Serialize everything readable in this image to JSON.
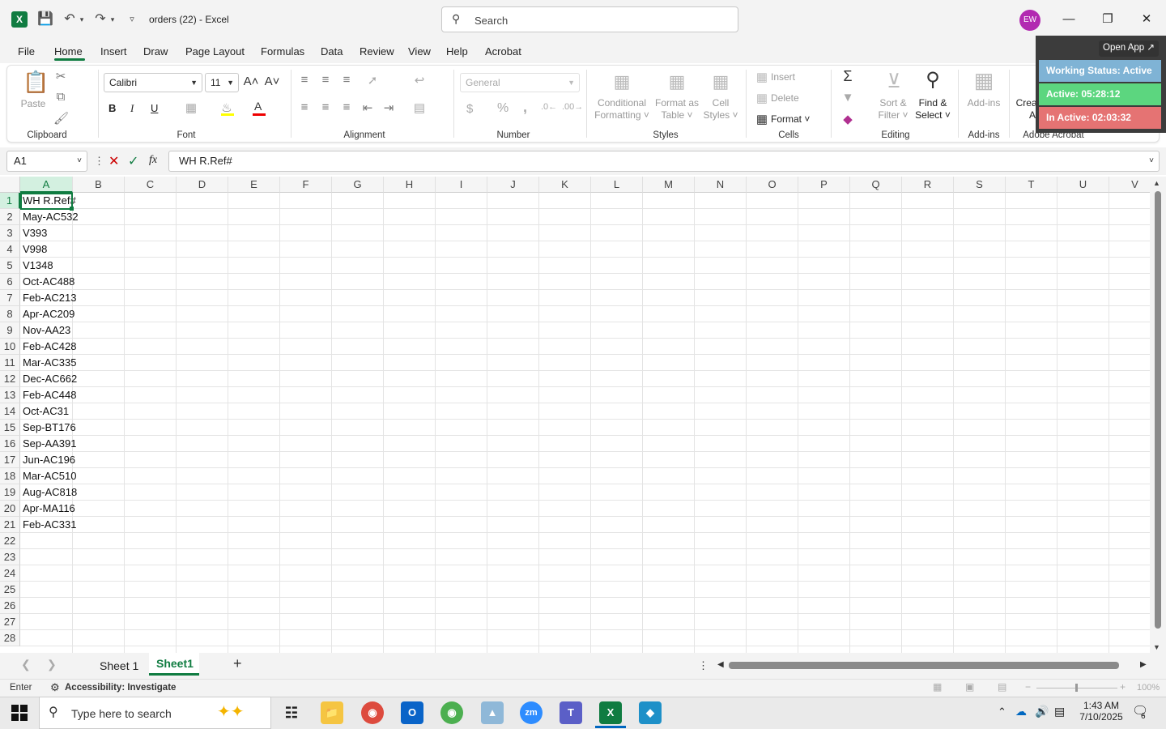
{
  "app": {
    "title": "orders (22)  -  Excel",
    "logo": "X",
    "search_placeholder": "Search",
    "avatar": "EW"
  },
  "menu": [
    "File",
    "Home",
    "Insert",
    "Draw",
    "Page Layout",
    "Formulas",
    "Data",
    "Review",
    "View",
    "Help",
    "Acrobat"
  ],
  "ribbon": {
    "clipboard": {
      "paste": "Paste",
      "label": "Clipboard"
    },
    "font": {
      "name": "Calibri",
      "size": "11",
      "label": "Font",
      "bold": "B",
      "italic": "I",
      "underline": "U"
    },
    "alignment": {
      "label": "Alignment"
    },
    "number": {
      "format": "General",
      "label": "Number",
      "currency": "$",
      "percent": "%",
      "comma": ","
    },
    "styles": {
      "conditional": "Conditional",
      "conditional2": "Formatting",
      "format_as": "Format as",
      "format_as2": "Table",
      "cell": "Cell",
      "cell2": "Styles",
      "label": "Styles"
    },
    "cells": {
      "insert": "Insert",
      "delete": "Delete",
      "format": "Format",
      "label": "Cells"
    },
    "editing": {
      "sort": "Sort &",
      "sort2": "Filter",
      "find": "Find &",
      "find2": "Select",
      "label": "Editing"
    },
    "addins": {
      "addins": "Add-ins",
      "label": "Add-ins"
    },
    "acrobat": {
      "create": "Create and Share",
      "create2": "Adobe PDF",
      "label": "Adobe Acrobat"
    }
  },
  "formula_bar": {
    "name_box": "A1",
    "fx": "fx",
    "content": "WH R.Ref#"
  },
  "columns": [
    "A",
    "B",
    "C",
    "D",
    "E",
    "F",
    "G",
    "H",
    "I",
    "J",
    "K",
    "L",
    "M",
    "N",
    "O",
    "P",
    "Q",
    "R",
    "S",
    "T",
    "U",
    "V"
  ],
  "rows": [
    "1",
    "2",
    "3",
    "4",
    "5",
    "6",
    "7",
    "8",
    "9",
    "10",
    "11",
    "12",
    "13",
    "14",
    "15",
    "16",
    "17",
    "18",
    "19",
    "20",
    "21",
    "22",
    "23",
    "24",
    "25",
    "26",
    "27",
    "28"
  ],
  "column_a": [
    "WH R.Ref#",
    "May-AC532",
    "V393",
    "V998",
    "V1348",
    "Oct-AC488",
    "Feb-AC213",
    "Apr-AC209",
    "Nov-AA23",
    "Feb-AC428",
    "Mar-AC335",
    "Dec-AC662",
    "Feb-AC448",
    "Oct-AC31",
    "Sep-BT176",
    "Sep-AA391",
    "Jun-AC196",
    "Mar-AC510",
    "Aug-AC818",
    "Apr-MA116",
    "Feb-AC331"
  ],
  "sheets": {
    "tab1": "Sheet 1",
    "tab2": "Sheet1",
    "add": "+"
  },
  "status": {
    "mode": "Enter",
    "accessibility": "Accessibility: Investigate",
    "zoom": "100%"
  },
  "overlay": {
    "open_app": "Open App ↗",
    "working": "Working Status: Active",
    "active": "Active: 05:28:12",
    "inactive": "In Active: 02:03:32"
  },
  "taskbar": {
    "search_placeholder": "Type here to search",
    "time": "1:43 AM",
    "date": "7/10/2025",
    "notifications": "6"
  },
  "colors": {
    "excel_green": "#107c41",
    "working": "#7fb3d5",
    "active": "#5cd67f",
    "inactive": "#e57373"
  }
}
